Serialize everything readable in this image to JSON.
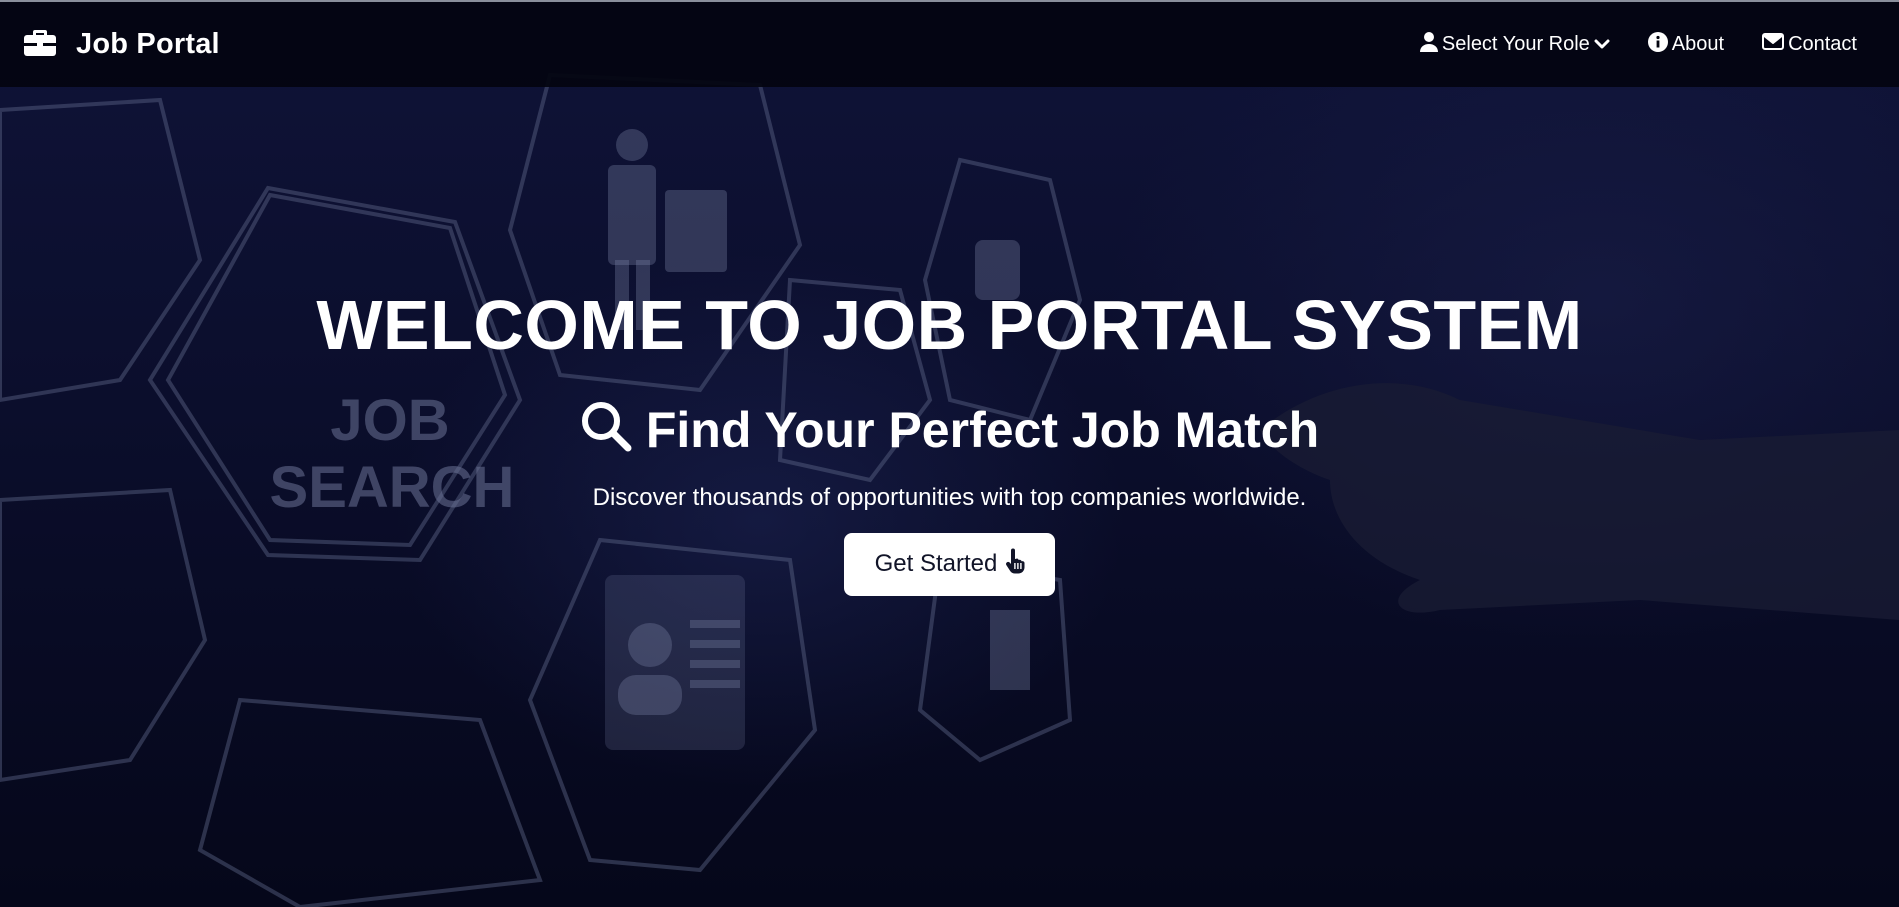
{
  "navbar": {
    "brand_icon": "briefcase-icon",
    "brand_label": "Job Portal",
    "links": [
      {
        "label": "Select Your Role",
        "icon": "user-icon",
        "trailing_icon": "chevron-down-icon"
      },
      {
        "label": "About",
        "icon": "info-circle-icon"
      },
      {
        "label": "Contact",
        "icon": "envelope-icon"
      }
    ]
  },
  "hero": {
    "title": "WELCOME TO JOB PORTAL SYSTEM",
    "subtitle": "Find Your Perfect Job Match",
    "subtitle_icon": "magnifier-icon",
    "description": "Discover thousands of opportunities with top companies worldwide.",
    "cta_label": "Get Started",
    "cta_icon": "hand-pointer-icon"
  },
  "background": {
    "image_caption_line1": "JOB",
    "image_caption_line2": "SEARCH"
  },
  "colors": {
    "navbar_bg": "#03040f",
    "hero_bg": "#0b0e2c",
    "text": "#ffffff",
    "button_bg": "#ffffff",
    "button_text": "#111428"
  }
}
